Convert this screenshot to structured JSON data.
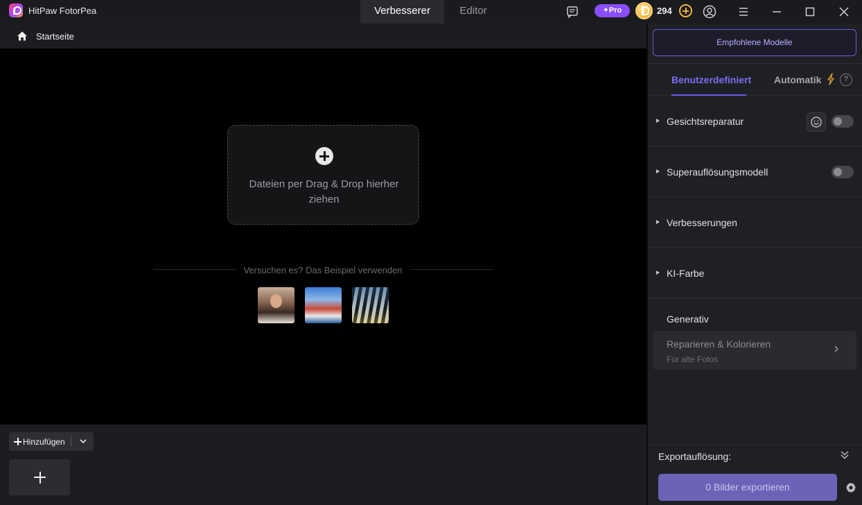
{
  "app": {
    "title": "HitPaw FotorPea"
  },
  "mode_tabs": {
    "active": "Verbesserer",
    "inactive": "Editor"
  },
  "account": {
    "pro_label": "✦Pro",
    "coins": "294"
  },
  "breadcrumb": {
    "home": "Startseite"
  },
  "canvas": {
    "drop_text": "Dateien per Drag & Drop hierher ziehen",
    "sample_label": "Versuchen es? Das Beispiel verwenden"
  },
  "bottom": {
    "add_label": "Hinzufügen"
  },
  "panel": {
    "models_button": "Empfohlene Modelle",
    "mode_custom": "Benutzerdefiniert",
    "mode_auto": "Automatik",
    "sections": [
      {
        "label": "Gesichtsreparatur",
        "toggle_on": false
      },
      {
        "label": "Superauflösungsmodell",
        "toggle_on": false
      },
      {
        "label": "Verbesserungen"
      },
      {
        "label": "KI-Farbe"
      }
    ],
    "generative": {
      "label": "Generativ",
      "card_title": "Reparieren & Kolorieren",
      "card_subtitle": "Für alte Fotos"
    },
    "export_resolution": "Exportauflösung:",
    "export_button": "0 Bilder exportieren"
  },
  "colors": {
    "accent": "#7d6cf5",
    "pro": "#8a4dff",
    "coin": "#f3b43c",
    "export_button": "#6c63b8"
  }
}
